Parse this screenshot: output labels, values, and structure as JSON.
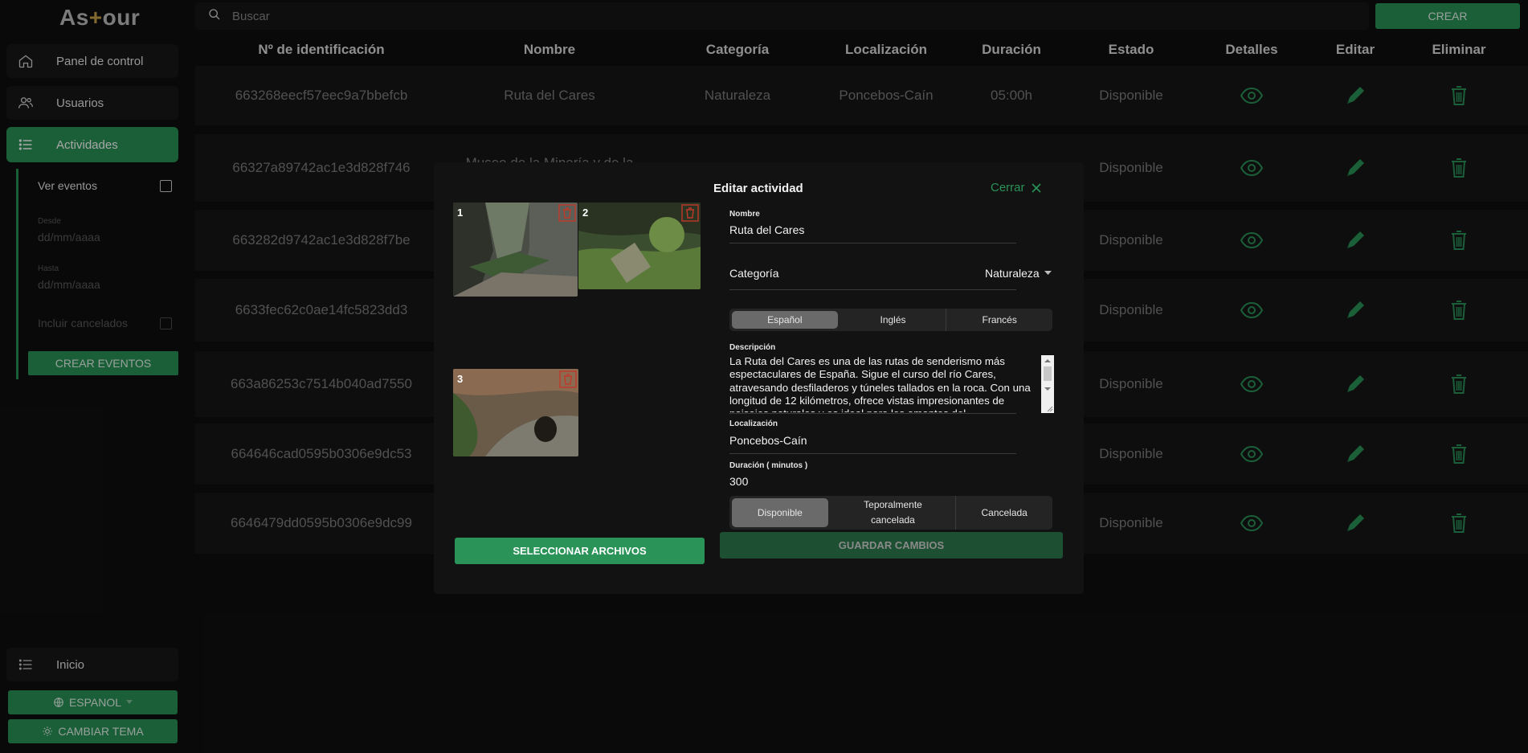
{
  "sidebar": {
    "logo": {
      "prefix": "As",
      "mark": "+",
      "suffix": "our"
    },
    "items": [
      {
        "label": "Panel de control",
        "icon": "home-icon"
      },
      {
        "label": "Usuarios",
        "icon": "users-icon"
      },
      {
        "label": "Actividades",
        "icon": "list-icon"
      }
    ],
    "sub": {
      "ver_eventos": "Ver eventos",
      "desde_label": "Desde",
      "desde_placeholder": "dd/mm/aaaa",
      "hasta_label": "Hasta",
      "hasta_placeholder": "dd/mm/aaaa",
      "incluir_cancelados": "Incluir cancelados",
      "crear_eventos": "CREAR EVENTOS"
    },
    "inicio": "Inicio",
    "language": "ESPANOL",
    "theme": "CAMBIAR TEMA"
  },
  "search": {
    "placeholder": "Buscar"
  },
  "crear": "CREAR",
  "table": {
    "headers": [
      "Nº de identificación",
      "Nombre",
      "Categoría",
      "Localización",
      "Duración",
      "Estado",
      "Detalles",
      "Editar",
      "Eliminar"
    ],
    "rows": [
      {
        "id": "663268eecf57eec9a7bbefcb",
        "nombre": "Ruta del Cares",
        "categoria": "Naturaleza",
        "localizacion": "Poncebos-Caín",
        "duracion": "05:00h",
        "estado": "Disponible"
      },
      {
        "id": "66327a89742ac1e3d828f746",
        "nombre": "Museo de la Minería y de la",
        "categoria": "",
        "localizacion": "",
        "duracion": "",
        "estado": "Disponible"
      },
      {
        "id": "663282d9742ac1e3d828f7be",
        "nombre": "",
        "categoria": "",
        "localizacion": "",
        "duracion": "",
        "estado": "Disponible"
      },
      {
        "id": "6633fec62c0ae14fc5823dd3",
        "nombre": "",
        "categoria": "",
        "localizacion": "",
        "duracion": "",
        "estado": "Disponible"
      },
      {
        "id": "663a86253c7514b040ad7550",
        "nombre": "",
        "categoria": "",
        "localizacion": "",
        "duracion": "",
        "estado": "Disponible"
      },
      {
        "id": "664646cad0595b0306e9dc53",
        "nombre": "",
        "categoria": "",
        "localizacion": "",
        "duracion": "",
        "estado": "Disponible"
      },
      {
        "id": "6646479dd0595b0306e9dc99",
        "nombre": "",
        "categoria": "",
        "localizacion": "",
        "duracion": "",
        "estado": "Disponible"
      }
    ]
  },
  "modal": {
    "title": "Editar actividad",
    "close_label": "Cerrar",
    "images": [
      "1",
      "2",
      "3"
    ],
    "select_files": "SELECCIONAR ARCHIVOS",
    "nombre_label": "Nombre",
    "nombre_value": "Ruta del Cares",
    "categoria_label": "Categoría",
    "categoria_value": "Naturaleza",
    "languages": [
      "Español",
      "Inglés",
      "Francés"
    ],
    "selected_language": "Español",
    "descripcion_label": "Descripción",
    "descripcion_value": "La Ruta del Cares es una de las rutas de senderismo más espectaculares de España. Sigue el curso del río Cares, atravesando desfiladeros y túneles tallados en la roca. Con una longitud de 12 kilómetros, ofrece vistas impresionantes de paisajes naturales y es ideal para los amantes del",
    "localizacion_label": "Localización",
    "localizacion_value": "Poncebos-Caín",
    "duracion_label": "Duración ( minutos )",
    "duracion_value": "300",
    "estados": [
      "Disponible",
      "Teporalmente cancelada",
      "Cancelada"
    ],
    "selected_estado": "Disponible",
    "save": "GUARDAR CAMBIOS"
  },
  "colors": {
    "accent": "#2a9358",
    "danger": "#c0392b",
    "background": "#0f0f0f"
  }
}
